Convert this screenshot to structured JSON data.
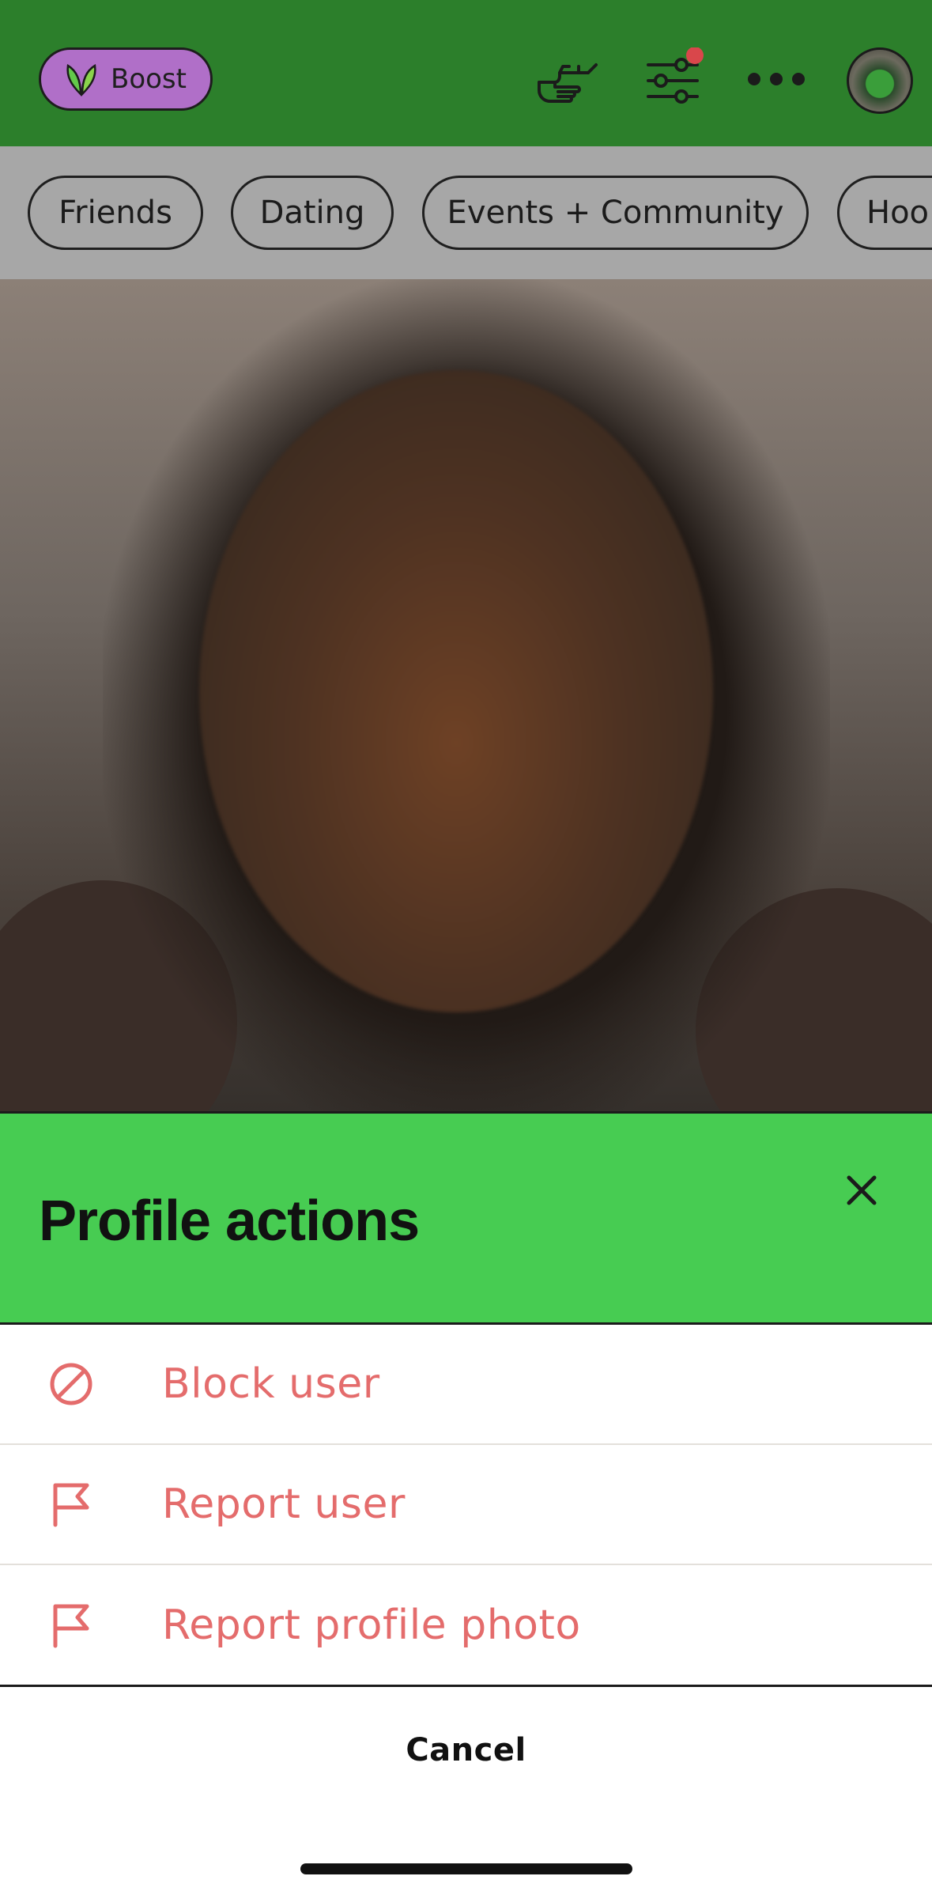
{
  "header": {
    "boost_label": "Boost",
    "icons": [
      "hand-pointing-icon",
      "filter-sliders-icon",
      "more-dots-icon",
      "profile-avatar"
    ],
    "filter_notification_color": "#d9474b",
    "bar_color": "#2c7f2b",
    "boost_color": "#b06fc8"
  },
  "filters": {
    "chips": [
      {
        "label": "Friends"
      },
      {
        "label": "Dating"
      },
      {
        "label": "Events + Community"
      },
      {
        "label": "Hoo"
      }
    ]
  },
  "sheet": {
    "title": "Profile actions",
    "header_color": "#47cc52",
    "actions": [
      {
        "label": "Block user",
        "icon": "block-icon"
      },
      {
        "label": "Report user",
        "icon": "flag-icon"
      },
      {
        "label": "Report profile photo",
        "icon": "flag-icon"
      }
    ],
    "action_text_color": "#e46c6c",
    "cancel_label": "Cancel"
  }
}
